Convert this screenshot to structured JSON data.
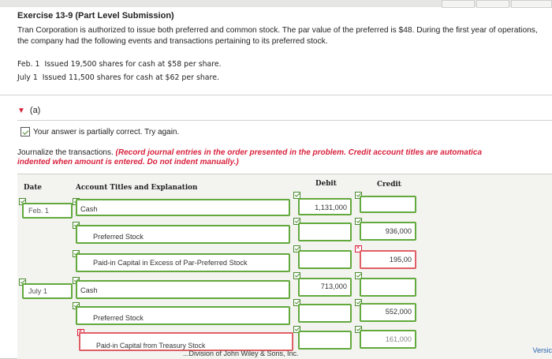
{
  "exercise": {
    "title": "Exercise 13-9 (Part Level Submission)",
    "description": "Tran Corporation is authorized to issue both preferred and common stock. The par value of the preferred is $48. During the first year of operations, the company had the following events and transactions pertaining to its preferred stock.",
    "events": [
      "Feb. 1  Issued 19,500 shares for cash at $58 per share.",
      "July 1  Issued 11,500 shares for cash at $62 per share."
    ]
  },
  "part": {
    "label": "(a)",
    "feedback": "Your answer is partially correct.  Try again.",
    "instruction_plain": "Journalize the transactions. ",
    "instruction_emphasis": "(Record journal entries in the order presented in the problem. Credit account titles are automatica",
    "instruction_line2": "indented when amount is entered. Do not indent manually.)"
  },
  "table": {
    "headers": {
      "date": "Date",
      "account": "Account Titles and Explanation",
      "debit": "Debit",
      "credit": "Credit"
    },
    "rows": [
      {
        "date": "Feb. 1",
        "account": "Cash",
        "debit": "1,131,000",
        "credit": ""
      },
      {
        "date": "",
        "account": "Preferred Stock",
        "debit": "",
        "credit": "936,000"
      },
      {
        "date": "",
        "account": "Paid-in Capital in Excess of Par-Preferred Stock",
        "debit": "",
        "credit": "195,00"
      },
      {
        "date": "July 1",
        "account": "Cash",
        "debit": "713,000",
        "credit": ""
      },
      {
        "date": "",
        "account": "Preferred Stock",
        "debit": "",
        "credit": "552,000"
      },
      {
        "date": "",
        "account": "Paid-in Capital from Treasury Stock",
        "debit": "",
        "credit": "161,000"
      }
    ]
  },
  "footer": {
    "copyright": "...Division of John Wiley & Sons, Inc.",
    "version": "Versic"
  },
  "colors": {
    "correct": "#63a93d",
    "incorrect": "#e05f65",
    "accent": "#d9213d"
  }
}
